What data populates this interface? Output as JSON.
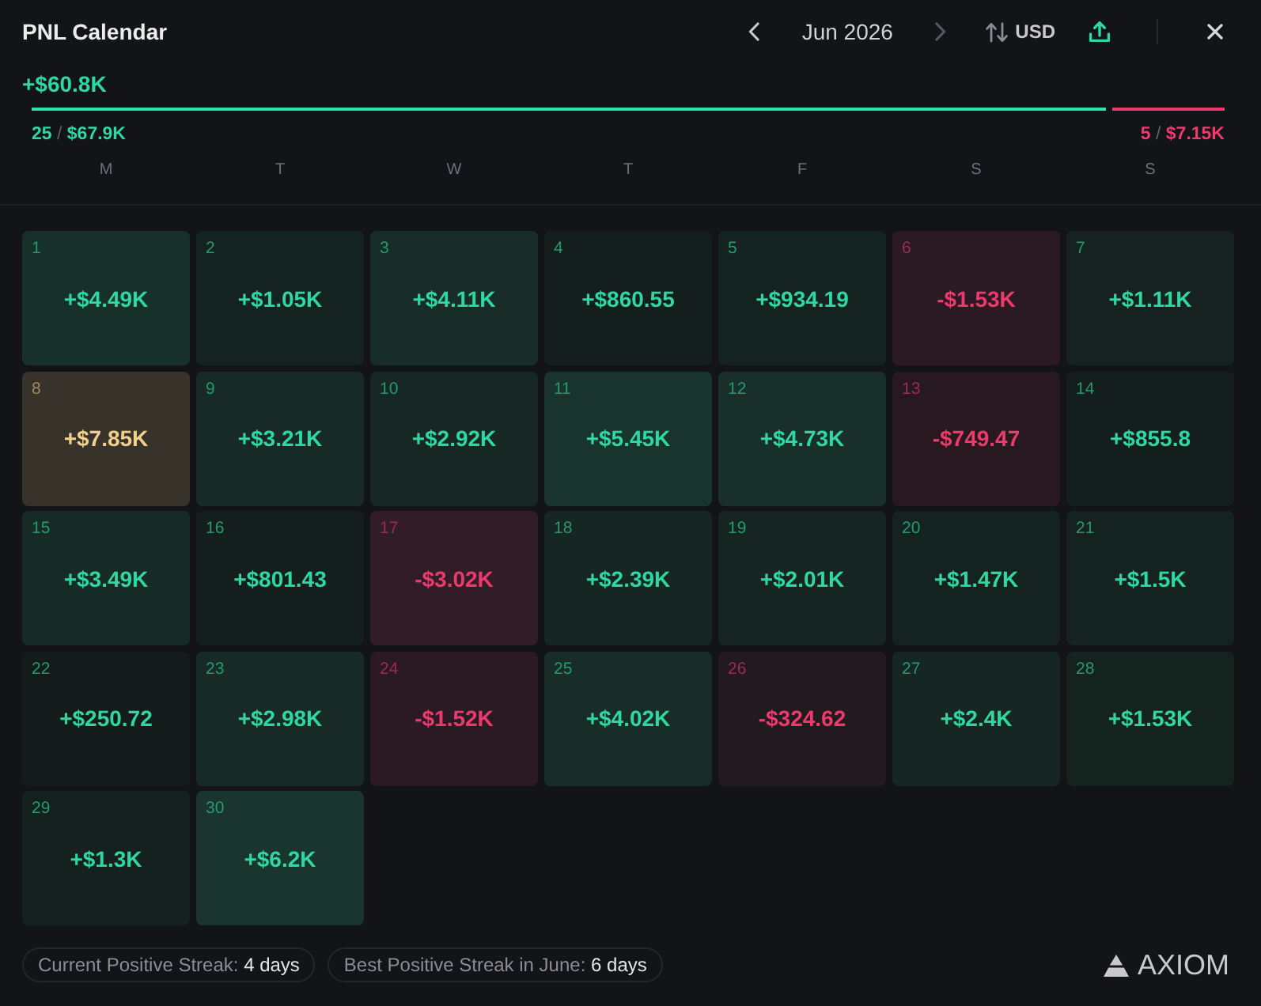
{
  "window": {
    "title": "PNL Calendar"
  },
  "header": {
    "prev_month": {
      "disabled": false
    },
    "month": "Jun 2026",
    "next_month": {
      "disabled": true
    },
    "currency": "USD"
  },
  "summary": {
    "total": "+$60.8K",
    "split_bar": {
      "level": 0.9
    },
    "wins": {
      "count": "25",
      "separator": "/",
      "amount": "$67.9K"
    },
    "losses": {
      "count": "5",
      "separator": "/",
      "amount": "$7.15K"
    }
  },
  "weekdays": [
    "M",
    "T",
    "W",
    "T",
    "F",
    "S",
    "S"
  ],
  "days": [
    {
      "day": "1",
      "value": "+$4.49K",
      "kind": "gain",
      "color": "#17302a"
    },
    {
      "day": "2",
      "value": "+$1.05K",
      "kind": "gain",
      "color": "#142320"
    },
    {
      "day": "3",
      "value": "+$4.11K",
      "kind": "gain",
      "color": "#192d28"
    },
    {
      "day": "4",
      "value": "+$860.55",
      "kind": "gain",
      "color": "#141f1d"
    },
    {
      "day": "5",
      "value": "+$934.19",
      "kind": "gain",
      "color": "#142320"
    },
    {
      "day": "6",
      "value": "-$1.53K",
      "kind": "loss",
      "color": "#2b1923"
    },
    {
      "day": "7",
      "value": "+$1.11K",
      "kind": "gain",
      "color": "#15221f"
    },
    {
      "day": "8",
      "value": "+$7.85K",
      "kind": "best",
      "color": "#38332a"
    },
    {
      "day": "9",
      "value": "+$3.21K",
      "kind": "gain",
      "color": "#172a26"
    },
    {
      "day": "10",
      "value": "+$2.92K",
      "kind": "gain",
      "color": "#172824"
    },
    {
      "day": "11",
      "value": "+$5.45K",
      "kind": "gain",
      "color": "#19342d"
    },
    {
      "day": "12",
      "value": "+$4.73K",
      "kind": "gain",
      "color": "#183029"
    },
    {
      "day": "13",
      "value": "-$749.47",
      "kind": "loss",
      "color": "#281921"
    },
    {
      "day": "14",
      "value": "+$855.8",
      "kind": "gain",
      "color": "#141f1d"
    },
    {
      "day": "15",
      "value": "+$3.49K",
      "kind": "gain",
      "color": "#172b26"
    },
    {
      "day": "16",
      "value": "+$801.43",
      "kind": "gain",
      "color": "#141f1d"
    },
    {
      "day": "17",
      "value": "-$3.02K",
      "kind": "loss",
      "color": "#321c28"
    },
    {
      "day": "18",
      "value": "+$2.39K",
      "kind": "gain",
      "color": "#162723"
    },
    {
      "day": "19",
      "value": "+$2.01K",
      "kind": "gain",
      "color": "#162521"
    },
    {
      "day": "20",
      "value": "+$1.47K",
      "kind": "gain",
      "color": "#152320"
    },
    {
      "day": "21",
      "value": "+$1.5K",
      "kind": "gain",
      "color": "#152320"
    },
    {
      "day": "22",
      "value": "+$250.72",
      "kind": "gain",
      "color": "#131c1a"
    },
    {
      "day": "23",
      "value": "+$2.98K",
      "kind": "gain",
      "color": "#172a25"
    },
    {
      "day": "24",
      "value": "-$1.52K",
      "kind": "loss",
      "color": "#2b1923"
    },
    {
      "day": "25",
      "value": "+$4.02K",
      "kind": "gain",
      "color": "#182d28"
    },
    {
      "day": "26",
      "value": "-$324.62",
      "kind": "loss",
      "color": "#231a1f"
    },
    {
      "day": "27",
      "value": "+$2.4K",
      "kind": "gain",
      "color": "#162723"
    },
    {
      "day": "28",
      "value": "+$1.53K",
      "kind": "gain",
      "color": "#15231f"
    },
    {
      "day": "29",
      "value": "+$1.3K",
      "kind": "gain",
      "color": "#15211e"
    },
    {
      "day": "30",
      "value": "+$6.2K",
      "kind": "gain",
      "color": "#1a352e"
    }
  ],
  "streaks": [
    {
      "label": "Current Positive Streak:",
      "value": "4 days"
    },
    {
      "label": "Best Positive Streak in June:",
      "value": "6 days"
    }
  ],
  "brand": {
    "name": "AXIOM"
  }
}
